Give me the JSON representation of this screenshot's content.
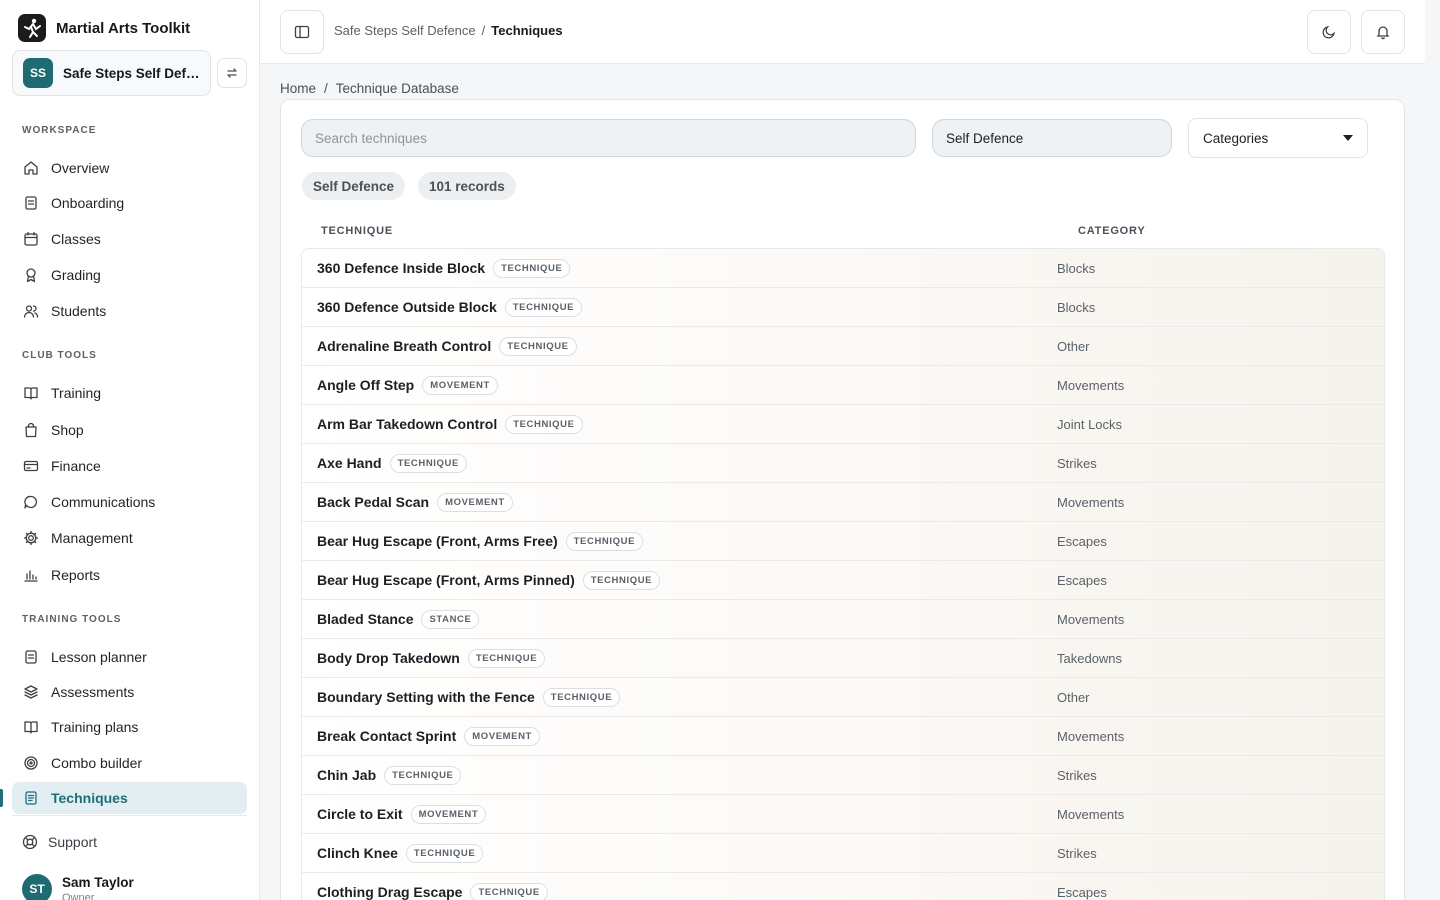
{
  "brand": {
    "name": "Martial Arts Toolkit"
  },
  "club": {
    "initials": "SS",
    "name": "Safe Steps Self Defence"
  },
  "sidebar": {
    "workspace_label": "WORKSPACE",
    "workspace": [
      {
        "label": "Overview",
        "icon": "home-icon"
      },
      {
        "label": "Onboarding",
        "icon": "clipboard-icon"
      },
      {
        "label": "Classes",
        "icon": "calendar-icon"
      },
      {
        "label": "Grading",
        "icon": "award-icon"
      },
      {
        "label": "Students",
        "icon": "users-icon"
      }
    ],
    "club_tools_label": "CLUB TOOLS",
    "club_tools": [
      {
        "label": "Training",
        "icon": "book-icon"
      },
      {
        "label": "Shop",
        "icon": "bag-icon"
      },
      {
        "label": "Finance",
        "icon": "card-icon"
      },
      {
        "label": "Communications",
        "icon": "chat-icon"
      },
      {
        "label": "Management",
        "icon": "gear-icon"
      },
      {
        "label": "Reports",
        "icon": "bar-chart-icon"
      }
    ],
    "training_tools_label": "TRAINING TOOLS",
    "training_tools": [
      {
        "label": "Lesson planner",
        "icon": "clipboard-icon"
      },
      {
        "label": "Assessments",
        "icon": "layers-icon"
      },
      {
        "label": "Training plans",
        "icon": "book-icon"
      },
      {
        "label": "Combo builder",
        "icon": "target-icon"
      },
      {
        "label": "Techniques",
        "icon": "document-icon",
        "active": true
      }
    ],
    "support_label": "Support",
    "user": {
      "initials": "ST",
      "name": "Sam Taylor",
      "role": "Owner"
    }
  },
  "topbar": {
    "club": "Safe Steps Self Defence",
    "separator": "/",
    "current": "Techniques"
  },
  "breadcrumb": {
    "home": "Home",
    "separator": "/",
    "current": "Technique Database"
  },
  "filters": {
    "search_placeholder": "Search techniques",
    "style": "Self Defence",
    "categories_label": "Categories"
  },
  "chips": {
    "style": "Self Defence",
    "records": "101 records"
  },
  "table": {
    "headers": {
      "technique": "TECHNIQUE",
      "category": "CATEGORY"
    },
    "rows": [
      {
        "name": "360 Defence Inside Block",
        "type": "TECHNIQUE",
        "category": "Blocks"
      },
      {
        "name": "360 Defence Outside Block",
        "type": "TECHNIQUE",
        "category": "Blocks"
      },
      {
        "name": "Adrenaline Breath Control",
        "type": "TECHNIQUE",
        "category": "Other"
      },
      {
        "name": "Angle Off Step",
        "type": "MOVEMENT",
        "category": "Movements"
      },
      {
        "name": "Arm Bar Takedown Control",
        "type": "TECHNIQUE",
        "category": "Joint Locks"
      },
      {
        "name": "Axe Hand",
        "type": "TECHNIQUE",
        "category": "Strikes"
      },
      {
        "name": "Back Pedal Scan",
        "type": "MOVEMENT",
        "category": "Movements"
      },
      {
        "name": "Bear Hug Escape (Front, Arms Free)",
        "type": "TECHNIQUE",
        "category": "Escapes"
      },
      {
        "name": "Bear Hug Escape (Front, Arms Pinned)",
        "type": "TECHNIQUE",
        "category": "Escapes"
      },
      {
        "name": "Bladed Stance",
        "type": "STANCE",
        "category": "Movements"
      },
      {
        "name": "Body Drop Takedown",
        "type": "TECHNIQUE",
        "category": "Takedowns"
      },
      {
        "name": "Boundary Setting with the Fence",
        "type": "TECHNIQUE",
        "category": "Other"
      },
      {
        "name": "Break Contact Sprint",
        "type": "MOVEMENT",
        "category": "Movements"
      },
      {
        "name": "Chin Jab",
        "type": "TECHNIQUE",
        "category": "Strikes"
      },
      {
        "name": "Circle to Exit",
        "type": "MOVEMENT",
        "category": "Movements"
      },
      {
        "name": "Clinch Knee",
        "type": "TECHNIQUE",
        "category": "Strikes"
      },
      {
        "name": "Clothing Drag Escape",
        "type": "TECHNIQUE",
        "category": "Escapes"
      }
    ]
  },
  "colors": {
    "accent": "#1c6f7b",
    "avatar": "#1f6b74",
    "active_bg": "#e3eef2"
  }
}
